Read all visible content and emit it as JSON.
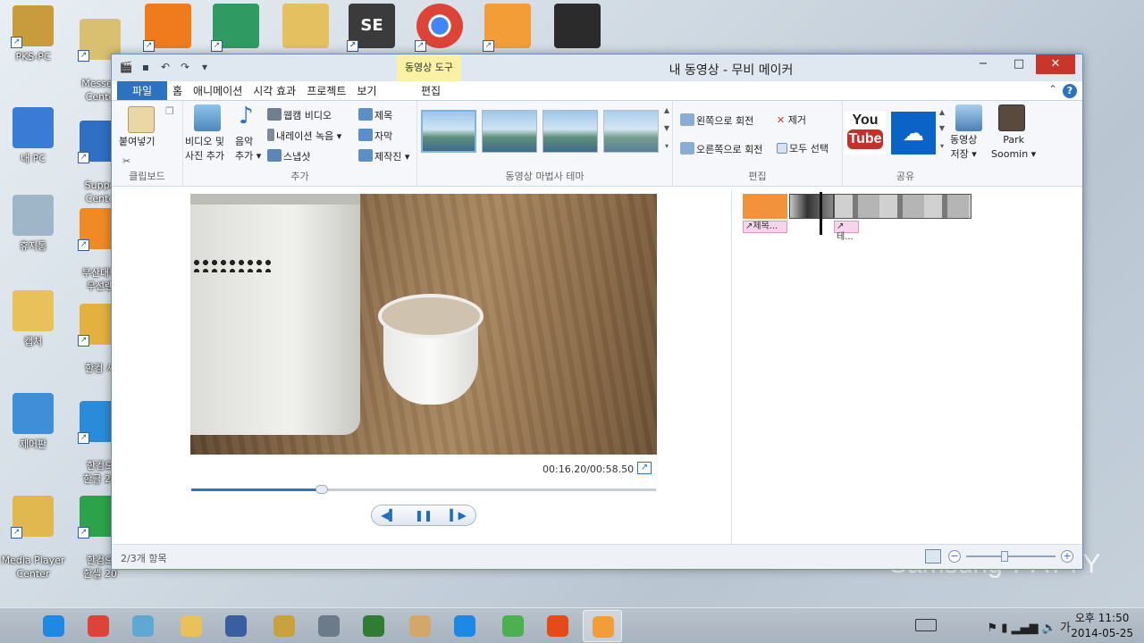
{
  "desktop": {
    "background_text": "Samsung 7 AYYY",
    "icons_left": [
      {
        "label": "PKS-PC",
        "icon": "user-folder-icon",
        "color": "#c89b3c"
      },
      {
        "label": "내 PC",
        "icon": "computer-icon",
        "color": "#3a7bd5"
      },
      {
        "label": "휴지통",
        "icon": "recycle-bin-icon",
        "color": "#9fb6c8"
      },
      {
        "label": "캡처",
        "icon": "folder-icon",
        "color": "#e8c15a"
      },
      {
        "label": "제어판",
        "icon": "control-panel-icon",
        "color": "#3f8fd8"
      },
      {
        "label": "Media Player\nCenter",
        "icon": "media-player-icon",
        "color": "#e0b84e"
      }
    ],
    "icons_second": [
      {
        "label": "Messen\nCente",
        "icon": "messenger-icon",
        "color": "#d9c070"
      },
      {
        "label": "Suppo\nCente",
        "icon": "support-center-icon",
        "color": "#2f6fc4"
      },
      {
        "label": "부산대학\n무선랜",
        "icon": "wireless-lan-icon",
        "color": "#f08a24"
      },
      {
        "label": "한컴 사",
        "icon": "hancom-dictionary-icon",
        "color": "#e3b13e"
      },
      {
        "label": "한컴오\n한글 20",
        "icon": "hangul-icon",
        "color": "#2a8cd8"
      },
      {
        "label": "한컴오\n한셀 20",
        "icon": "hancell-icon",
        "color": "#2ca34a"
      }
    ],
    "top_icons": [
      {
        "icon": "slideshow-icon",
        "color": "#f07b1d"
      },
      {
        "icon": "sync-icon",
        "color": "#2f9b63"
      },
      {
        "icon": "folder-docs-icon",
        "color": "#e5c061"
      },
      {
        "icon": "se-app-icon",
        "color": "#3b3b3b",
        "text": "SE"
      },
      {
        "icon": "chrome-icon",
        "color": "#db4437"
      },
      {
        "icon": "movie-maker-icon",
        "color": "#f29d38"
      },
      {
        "icon": "video-file-icon",
        "color": "#2b2b2b"
      }
    ]
  },
  "window": {
    "title": "내 동영상 - 무비 메이커",
    "tool_tab": "동영상 도구",
    "controls": {
      "minimize": "−",
      "maximize": "□",
      "close": "✕"
    },
    "tabs": [
      {
        "label": "파일",
        "type": "file"
      },
      {
        "label": "홈"
      },
      {
        "label": "애니메이션"
      },
      {
        "label": "시각 효과"
      },
      {
        "label": "프로젝트"
      },
      {
        "label": "보기"
      }
    ],
    "edit_tab": "편집",
    "help": "?",
    "ribbon": {
      "clipboard": {
        "paste": "붙여넣기",
        "group": "클립보드"
      },
      "add": {
        "video_photo": "비디오 및\n사진 추가",
        "music": "음악\n추가 ▾",
        "webcam": "웹캠 비디오",
        "narration": "내레이션 녹음 ▾",
        "snapshot": "스냅샷",
        "title": "제목",
        "caption": "자막",
        "credits": "제작진 ▾",
        "group": "추가"
      },
      "themes": {
        "group": "동영상 마법사 테마"
      },
      "editing": {
        "rotate_left": "왼쪽으로 회전",
        "rotate_right": "오른쪽으로 회전",
        "remove": "제거",
        "select_all": "모두 선택",
        "group": "편집"
      },
      "share": {
        "youtube_top": "You",
        "youtube_bottom": "Tube",
        "save_movie": "동영상\n저장 ▾",
        "user": "Park\nSoomin ▾",
        "group": "공유"
      }
    },
    "preview": {
      "timecode": "00:16.20/00:58.50",
      "progress": 0.28
    },
    "storyboard": {
      "title_caption": "제목...",
      "text_caption": "테..."
    },
    "status": {
      "items": "2/3개 항목",
      "zoom_level": 0.43
    }
  },
  "taskbar": {
    "apps": [
      {
        "icon": "ie-icon",
        "color": "#1e88e5"
      },
      {
        "icon": "chrome-taskbar-icon",
        "color": "#db4437"
      },
      {
        "icon": "pen-app-icon",
        "color": "#5fa8d3"
      },
      {
        "icon": "explorer-icon",
        "color": "#e8c15a"
      },
      {
        "icon": "help-app-icon",
        "color": "#3a5fa0"
      },
      {
        "icon": "security-app-icon",
        "color": "#c9a23f"
      },
      {
        "icon": "question-app-icon",
        "color": "#6c7a8a"
      },
      {
        "icon": "green-app-icon",
        "color": "#2e7d32"
      },
      {
        "icon": "paint-icon",
        "color": "#d2a86a"
      },
      {
        "icon": "live-player-icon",
        "color": "#1e88e5"
      },
      {
        "icon": "utorrent-icon",
        "color": "#4caf50"
      },
      {
        "icon": "slides-app-icon",
        "color": "#e64a19"
      },
      {
        "icon": "movie-maker-taskbar-icon",
        "color": "#f29d38",
        "active": true
      }
    ],
    "time": "오후 11:50",
    "date": "2014-05-25",
    "ime": "가"
  }
}
